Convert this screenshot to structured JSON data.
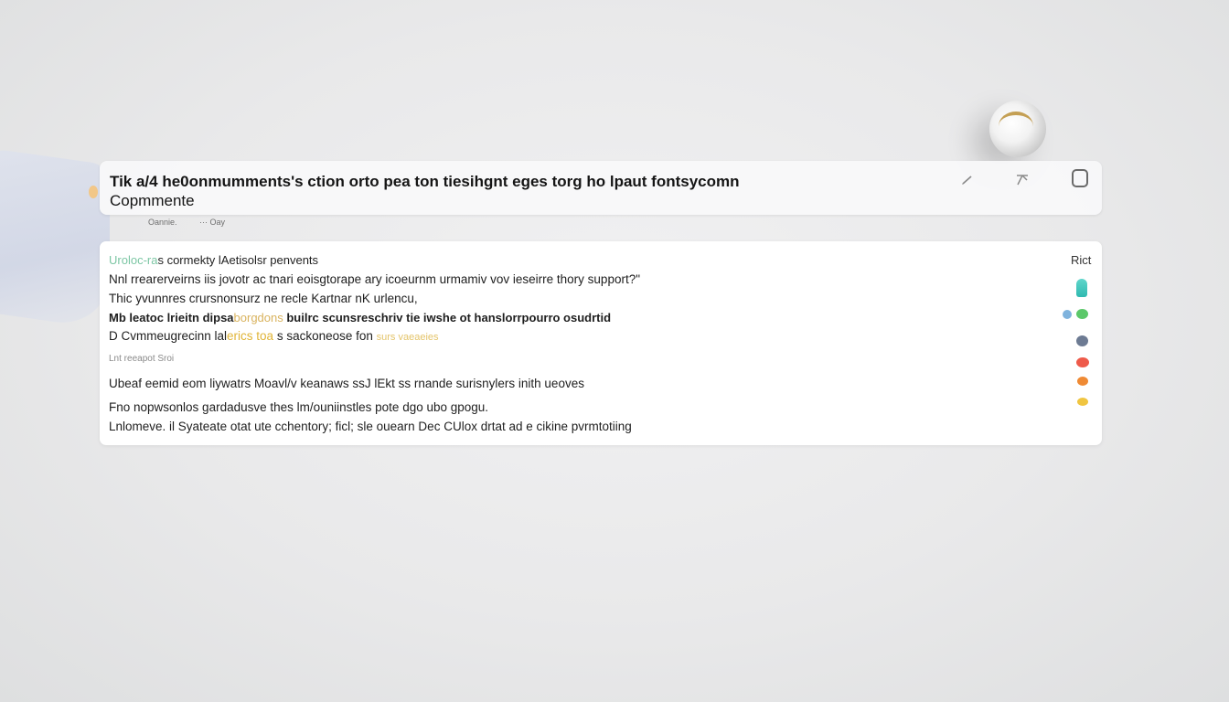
{
  "header": {
    "title_line1": "Tik a/4 he0onmumments's ction orto pea ton tiesihgnt eges torg ho lpaut fontsycomn",
    "title_line2": "Copmmente",
    "edit_icon": "pencil-icon",
    "pin_icon": "pin-icon",
    "window_icon": "square-icon"
  },
  "meta": {
    "left": "Oannie.",
    "right": "··· Oay"
  },
  "content": {
    "line1_tag": "Uroloc-ra",
    "line1_text": "s cormekty lAetisolsr penvents",
    "line2": "Nnl rrearerveirns iis jovotr ac tnari eoisgtorape ary icoeurnm urmamiv vov ieseirre thory support?\"",
    "line3": "Thic yvunnres crursnonsurz ne recle Kartnar nK urlencu,",
    "line4_a": "Mb leatoc lrieitn dipsa",
    "line4_fade": "borgdons",
    "line4_b": " builrc scunsreschriv tie iwshe ot hanslorrpourro osudrtid",
    "line5_a": "D Cvmmeugrecinn lal",
    "line5_gold": "erics toa",
    "line5_b": "  s sackoneose fon ",
    "line5_goldlight": "surs vaeaeies",
    "line6": "Lnt reeapot Sroi",
    "line7": "Ubeaf eemid eom liywatrs Moavl/v keanaws ssJ lEkt ss rnande surisnylers inith ueoves",
    "line8": "Fno nopwsonlos gardadusve thes lm/ouniinstles pote dgo ubo gpogu.",
    "line9": "Lnlomeve. il Syateate otat ute cchentory; ficl; sle ouearn Dec CUlox drtat ad e cikine pvrmtotiing",
    "right_label": "Rict"
  },
  "icons": {
    "person": "person-icon",
    "dots": [
      "blue-dot-icon",
      "green-dot-icon",
      "slate-dot-icon",
      "red-dot-icon",
      "orange-dot-icon",
      "yellow-dot-icon"
    ]
  },
  "colors": {
    "green_tag": "#7cc6a4",
    "gold": "#e0b436",
    "teal": "#2fb9b0",
    "red": "#ee5a4a",
    "orange": "#ef8a34",
    "yellow": "#f0c541",
    "slate": "#6d7b93"
  }
}
